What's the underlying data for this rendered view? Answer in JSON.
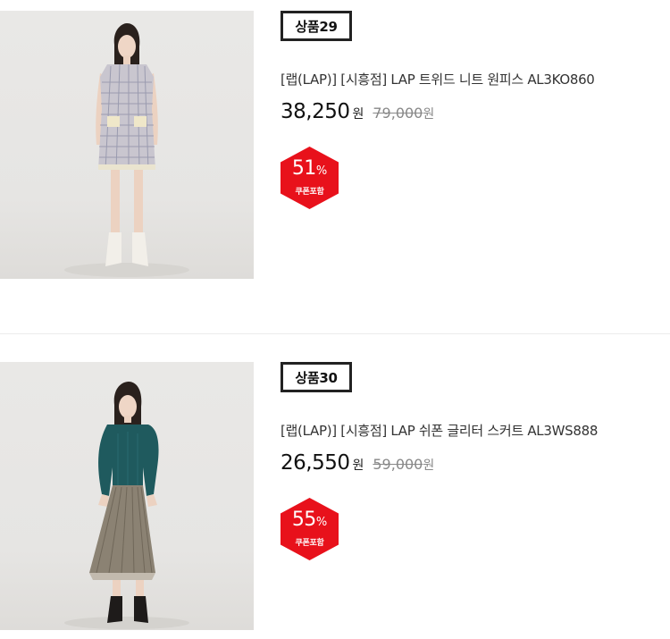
{
  "products": [
    {
      "rank_label": "상품29",
      "name": "[랩(LAP)] [시흥점] LAP 트위드 니트 원피스 AL3KO860",
      "sale_price": "38,250",
      "sale_unit": "원",
      "original_price": "79,000",
      "original_unit": "원",
      "discount_number": "51",
      "discount_sign": "%",
      "coupon_label": "쿠폰포함",
      "image_icon": "product-photo-tweed-dress"
    },
    {
      "rank_label": "상품30",
      "name": "[랩(LAP)] [시흥점] LAP 쉬폰 글리터 스커트 AL3WS888",
      "sale_price": "26,550",
      "sale_unit": "원",
      "original_price": "59,000",
      "original_unit": "원",
      "discount_number": "55",
      "discount_sign": "%",
      "coupon_label": "쿠폰포함",
      "image_icon": "product-photo-glitter-skirt"
    }
  ],
  "colors": {
    "badge_red": "#e8111b",
    "text_dark": "#111111",
    "text_muted": "#888888",
    "divider": "#ececec"
  }
}
